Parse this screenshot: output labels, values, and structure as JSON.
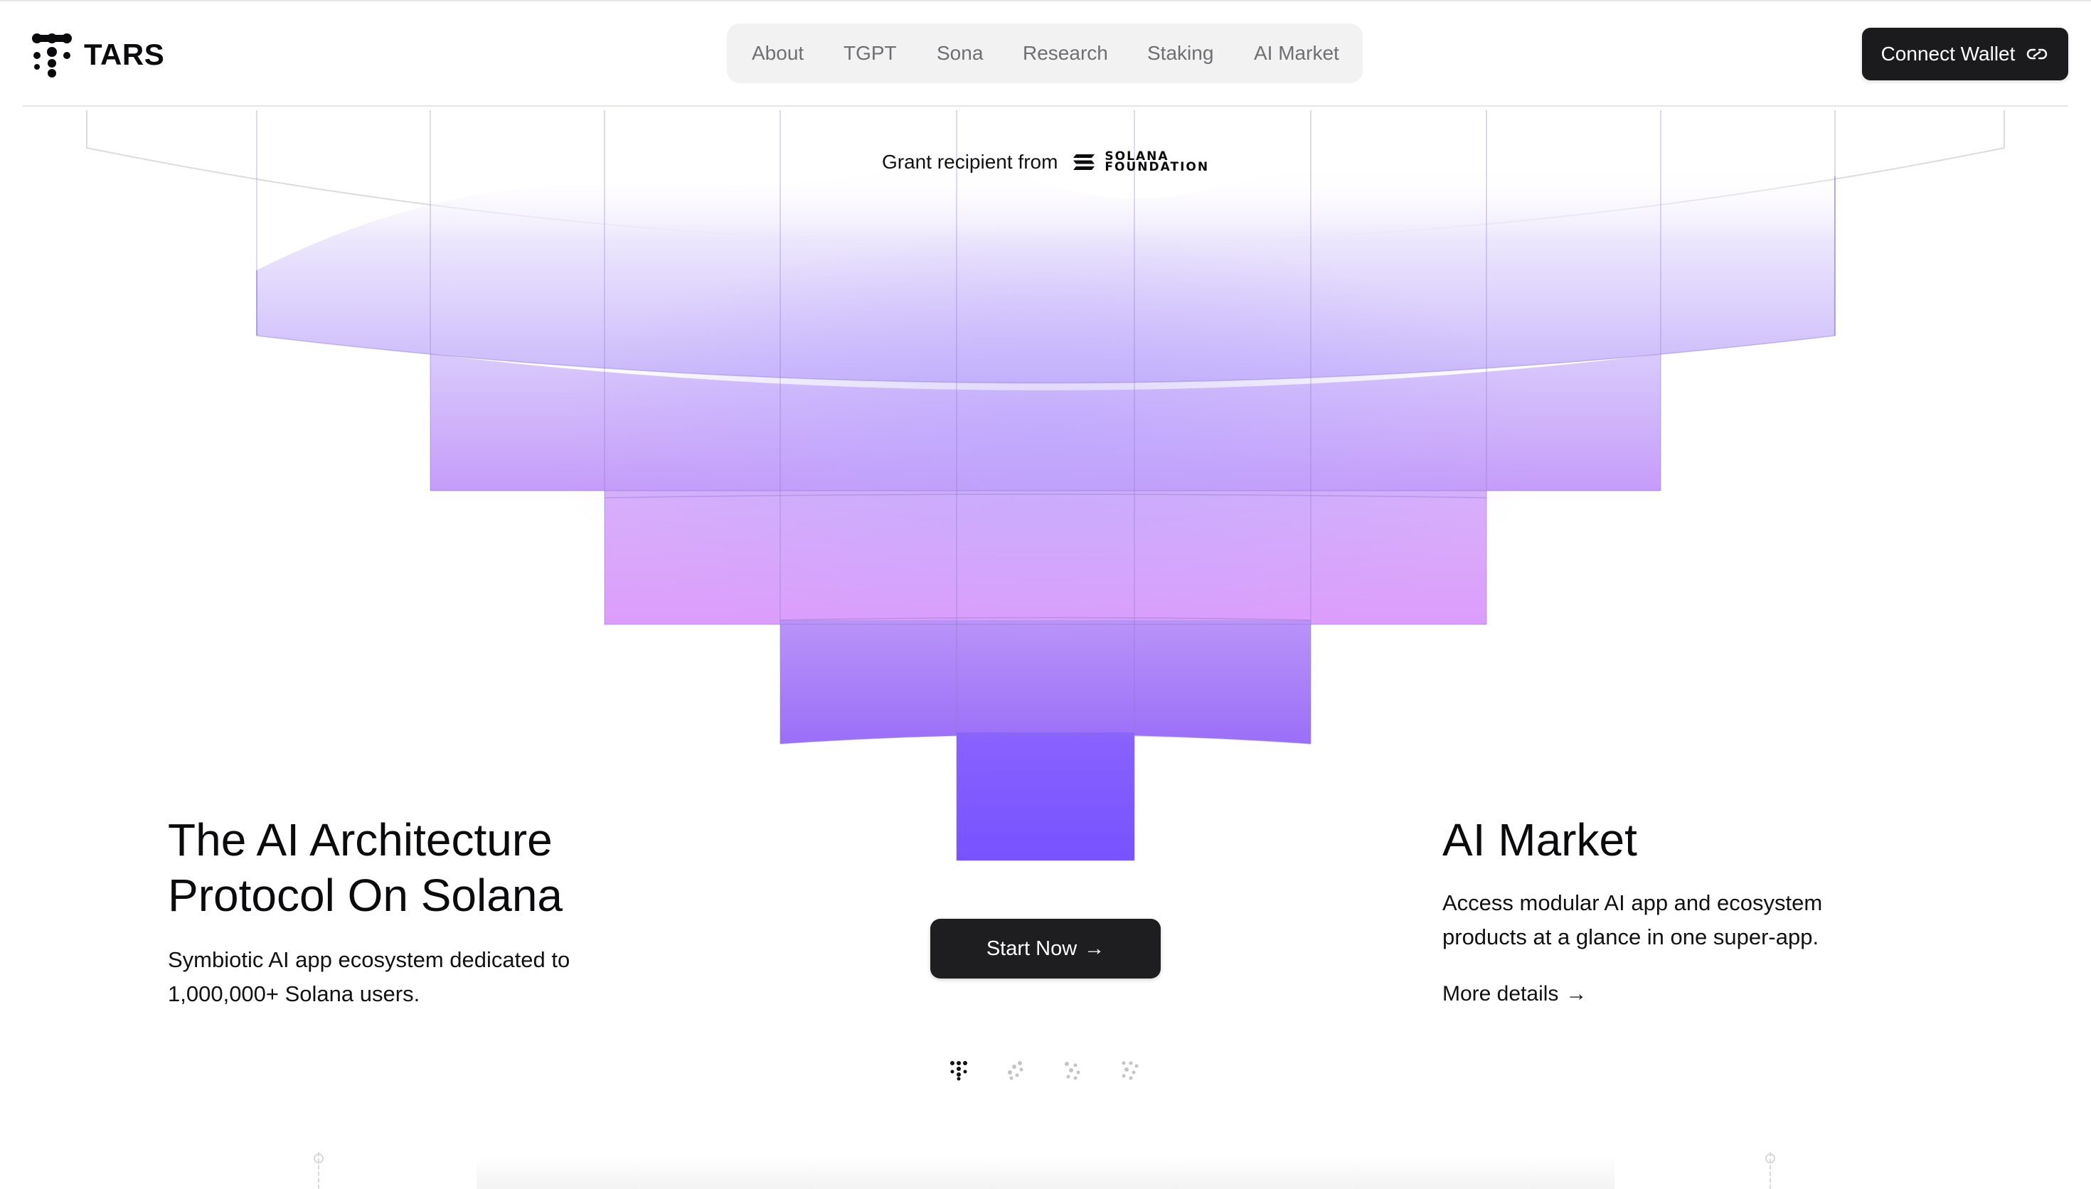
{
  "brand": {
    "name": "TARS",
    "logo_icon": "tars-logo-icon"
  },
  "nav": {
    "items": [
      {
        "label": "About"
      },
      {
        "label": "TGPT"
      },
      {
        "label": "Sona"
      },
      {
        "label": "Research"
      },
      {
        "label": "Staking"
      },
      {
        "label": "AI Market"
      }
    ]
  },
  "header": {
    "connect_label": "Connect Wallet",
    "connect_icon": "link-icon"
  },
  "grant": {
    "text": "Grant recipient from",
    "partner_line1": "SOLANA",
    "partner_line2": "FOUNDATION",
    "partner_icon": "solana-icon"
  },
  "hero": {
    "title_line1": "The AI Architecture",
    "title_line2": "Protocol On Solana",
    "desc_line1": "Symbiotic AI app ecosystem dedicated to",
    "desc_line2": "1,000,000+ Solana users.",
    "cta_label": "Start Now",
    "cta_arrow": "→"
  },
  "market": {
    "title": "AI Market",
    "desc_line1": "Access modular AI app and ecosystem",
    "desc_line2": "products at a glance in one super-app.",
    "link_label": "More details",
    "link_arrow": "→"
  },
  "carousel": {
    "count": 4,
    "active_index": 0
  },
  "colors": {
    "accent_deep": "#7b55ff",
    "accent_mid": "#a47cf6",
    "accent_pink": "#dd9efd",
    "accent_light": "#e9e1fb",
    "button_dark": "#1b1b1d"
  }
}
